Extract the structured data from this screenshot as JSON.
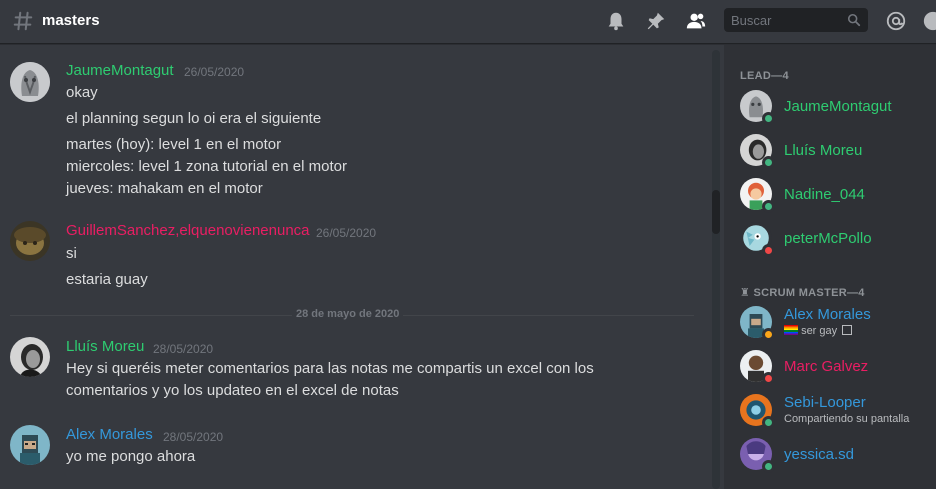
{
  "header": {
    "channel": "masters",
    "search_placeholder": "Buscar",
    "icons": [
      "hashtag-icon",
      "bell-icon",
      "pin-icon",
      "members-icon",
      "search-icon",
      "at-icon",
      "help-icon"
    ]
  },
  "colors": {
    "green": "#43b581",
    "green_name": "#2ecc71",
    "red_name": "#e91e63",
    "blue_name": "#3498db",
    "online": "#43b581",
    "dnd": "#f04747",
    "idle": "#faa61a"
  },
  "messages": [
    {
      "author": "JaumeMontagut",
      "timestamp": "26/05/2020",
      "lines": [
        "okay",
        "el planning segun lo oi era el siguiente",
        "martes (hoy): level 1 en el motor",
        "miercoles: level 1 zona tutorial en el motor",
        "jueves: mahakam en el motor"
      ]
    },
    {
      "author": "GuillemSanchez,elquenovienenunca",
      "timestamp": "26/05/2020",
      "lines": [
        "si",
        "estaria guay"
      ]
    },
    {
      "author": "Lluís Moreu",
      "timestamp": "28/05/2020",
      "lines": [
        "Hey si queréis meter comentarios para las notas me compartis un excel con los",
        "comentarios y yo los updateo en el excel de notas"
      ]
    },
    {
      "author": "Alex Morales",
      "timestamp": "28/05/2020",
      "lines": [
        "yo me pongo ahora"
      ]
    }
  ],
  "date_divider": "28 de mayo de 2020",
  "member_list": {
    "roles": [
      {
        "title": "LEAD—4",
        "members": [
          {
            "name": "JaumeMontagut",
            "status": "online"
          },
          {
            "name": "Lluís Moreu",
            "status": "online"
          },
          {
            "name": "Nadine_044",
            "status": "online"
          },
          {
            "name": "peterMcPollo",
            "status": "dnd"
          }
        ]
      },
      {
        "title": "SCRUM MASTER—4",
        "members": [
          {
            "name": "Alex Morales",
            "status": "idle",
            "sub": "ser gay"
          },
          {
            "name": "Marc Galvez",
            "status": "dnd"
          },
          {
            "name": "Sebi-Looper",
            "status": "online",
            "sub": "Compartiendo su pantalla"
          },
          {
            "name": "yessica.sd",
            "status": "online"
          }
        ]
      }
    ]
  }
}
